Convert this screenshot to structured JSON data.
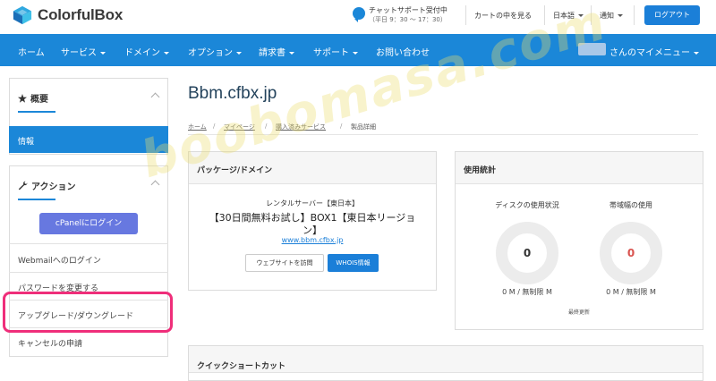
{
  "header": {
    "brand": "ColorfulBox",
    "chat_title": "チャットサポート受付中",
    "chat_hours": "（平日 9：30 ～ 17：30）",
    "cart_link": "カートの中を見る",
    "language": "日本語",
    "notifications": "通知",
    "logout": "ログアウト"
  },
  "nav": {
    "items": [
      "ホーム",
      "サービス",
      "ドメイン",
      "オプション",
      "請求書",
      "サポート",
      "お問い合わせ"
    ],
    "account_menu": "さんのマイメニュー"
  },
  "sidebar": {
    "overview_title": "概要",
    "overview_active": "情報",
    "actions_title": "アクション",
    "cpanel_button": "cPanelにログイン",
    "links": [
      "Webmailへのログイン",
      "パスワードを変更する",
      "アップグレード/ダウングレード",
      "キャンセルの申請"
    ]
  },
  "main": {
    "title": "Bbm.cfbx.jp",
    "breadcrumb": [
      "ホーム",
      "マイページ",
      "購入済みサービス"
    ],
    "breadcrumb_current": "製品詳細",
    "package": {
      "title": "パッケージ/ドメイン",
      "group": "レンタルサーバー【東日本】",
      "product_line1": "【30日間無料お試し】BOX1【東日本リージョ",
      "product_line2": "ン】",
      "domain": "www.bbm.cfbx.jp",
      "visit_button": "ウェブサイトを訪問",
      "whois_button": "WHOIS情報"
    },
    "usage": {
      "title": "使用統計",
      "disk_label": "ディスクの使用状況",
      "disk_value": "0",
      "disk_detail": "0 M / 無制限 M",
      "bandwidth_label": "帯域幅の使用",
      "bandwidth_value": "0",
      "bandwidth_detail": "0 M / 無制限 M",
      "last_updated": "最終更新"
    },
    "shortcuts_title": "クイックショートカット"
  },
  "watermark": "boobomasa.com",
  "colors": {
    "brand": "#1b87d8",
    "cpanel": "#6778e0",
    "highlight": "#ef2e7a",
    "disk_value": "#333333",
    "bandwidth_value": "#d9534f"
  }
}
